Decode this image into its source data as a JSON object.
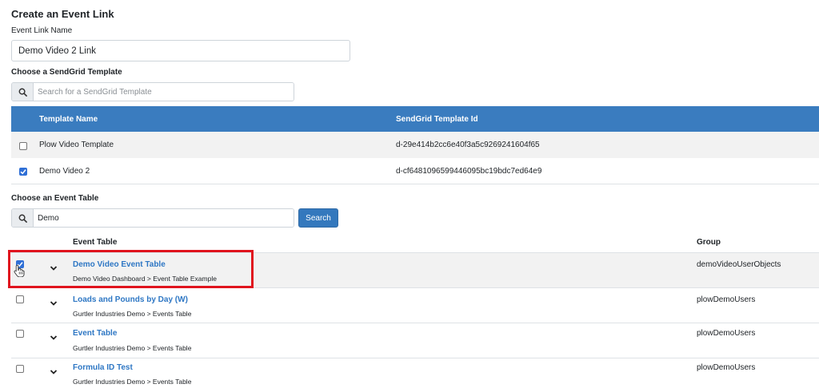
{
  "page": {
    "title": "Create an Event Link"
  },
  "event_link": {
    "label": "Event Link Name",
    "value": "Demo Video 2 Link"
  },
  "template_section": {
    "label": "Choose a SendGrid Template",
    "search_placeholder": "Search for a SendGrid Template",
    "columns": {
      "name": "Template Name",
      "id": "SendGrid Template Id"
    },
    "rows": [
      {
        "name": "Plow Video Template",
        "id": "d-29e414b2cc6e40f3a5c9269241604f65",
        "checked": false
      },
      {
        "name": "Demo Video 2",
        "id": "d-cf6481096599446095bc19bdc7ed64e9",
        "checked": true
      }
    ]
  },
  "event_table_section": {
    "label": "Choose an Event Table",
    "search_value": "Demo",
    "search_button": "Search",
    "columns": {
      "table": "Event Table",
      "group": "Group"
    },
    "rows": [
      {
        "name": "Demo Video Event Table",
        "path": "Demo Video Dashboard > Event Table Example",
        "group": "demoVideoUserObjects",
        "checked": true
      },
      {
        "name": "Loads and Pounds by Day (W)",
        "path": "Gurtler Industries Demo > Events Table",
        "group": "plowDemoUsers",
        "checked": false
      },
      {
        "name": "Event Table",
        "path": "Gurtler Industries Demo > Events Table",
        "group": "plowDemoUsers",
        "checked": false
      },
      {
        "name": "Formula ID Test",
        "path": "Gurtler Industries Demo > Events Table",
        "group": "plowDemoUsers",
        "checked": false
      }
    ]
  },
  "icons": {
    "search": "search-icon",
    "expand": "chevron-down-icon",
    "cursor": "hand-pointer-icon"
  },
  "colors": {
    "accent": "#3a7cbf",
    "link": "#2e77c4",
    "highlight": "#e0141e",
    "checkbox": "#2f6fd6"
  }
}
